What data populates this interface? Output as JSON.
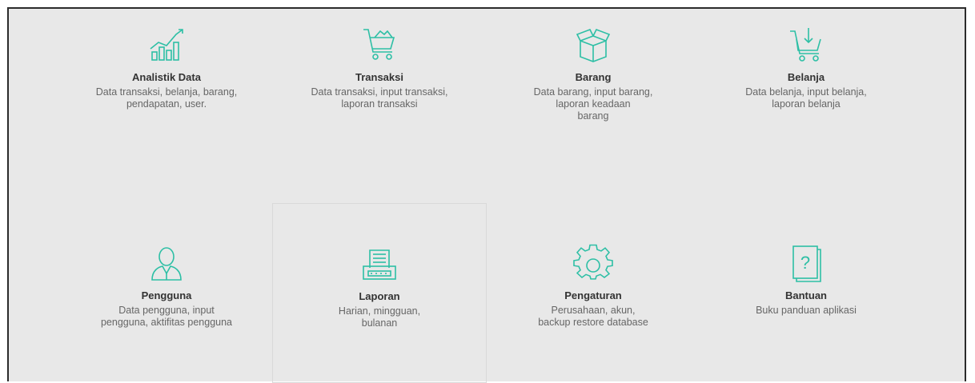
{
  "accent_color": "#2dbfa5",
  "tiles": [
    {
      "icon": "analytics-chart-icon",
      "title": "Analistik Data",
      "desc": "Data transaksi, belanja, barang,\npendapatan, user."
    },
    {
      "icon": "shopping-cart-icon",
      "title": "Transaksi",
      "desc": "Data transaksi, input transaksi,\nlaporan transaksi"
    },
    {
      "icon": "box-icon",
      "title": "Barang",
      "desc": "Data barang, input barang,\nlaporan keadaan\nbarang"
    },
    {
      "icon": "cart-download-icon",
      "title": "Belanja",
      "desc": "Data belanja, input belanja,\nlaporan belanja"
    },
    {
      "icon": "user-icon",
      "title": "Pengguna",
      "desc": "Data pengguna, input\npengguna, aktifitas pengguna"
    },
    {
      "icon": "printer-report-icon",
      "title": "Laporan",
      "desc": "Harian, mingguan,\nbulanan"
    },
    {
      "icon": "gear-icon",
      "title": "Pengaturan",
      "desc": "Perusahaan, akun,\nbackup restore database"
    },
    {
      "icon": "help-book-icon",
      "title": "Bantuan",
      "desc": "Buku panduan aplikasi"
    }
  ]
}
